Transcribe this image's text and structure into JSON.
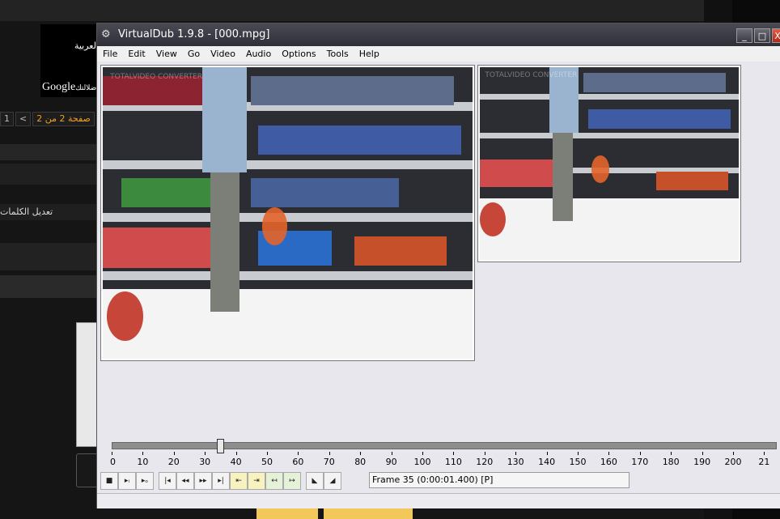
{
  "background_page": {
    "google_box": {
      "arabic_text": "العربية",
      "logo_text": "Google",
      "logo_suffix": "ضلالتك"
    },
    "pager": {
      "label": "صفحة 2 من 2",
      "prev": "<",
      "first": "1"
    },
    "edit_words": "تعديل الكلمات"
  },
  "window": {
    "title": "VirtualDub 1.9.8 - [000.mpg]",
    "minimize_label": "_",
    "maximize_label": "□",
    "close_label": "X"
  },
  "menu": [
    "File",
    "Edit",
    "View",
    "Go",
    "Video",
    "Audio",
    "Options",
    "Tools",
    "Help"
  ],
  "panes": {
    "input_watermark": "TOTALVIDEO CONVERTER",
    "output_watermark": "TOTALVIDEO CONVERTER"
  },
  "timeline": {
    "ticks": [
      "0",
      "10",
      "20",
      "30",
      "40",
      "50",
      "60",
      "70",
      "80",
      "90",
      "100",
      "110",
      "120",
      "130",
      "140",
      "150",
      "160",
      "170",
      "180",
      "190",
      "200",
      "21"
    ],
    "position_frame": 35,
    "max_frame": 215
  },
  "toolbar": {
    "groups": [
      [
        "stop",
        "play-input",
        "play-output"
      ],
      [
        "start",
        "prev-key",
        "next-key",
        "end",
        "prev-keyframe",
        "next-keyframe",
        "prev-scene",
        "next-scene"
      ],
      [
        "mark-in",
        "mark-out"
      ]
    ]
  },
  "frame_status": "Frame 35 (0:00:01.400) [P]"
}
